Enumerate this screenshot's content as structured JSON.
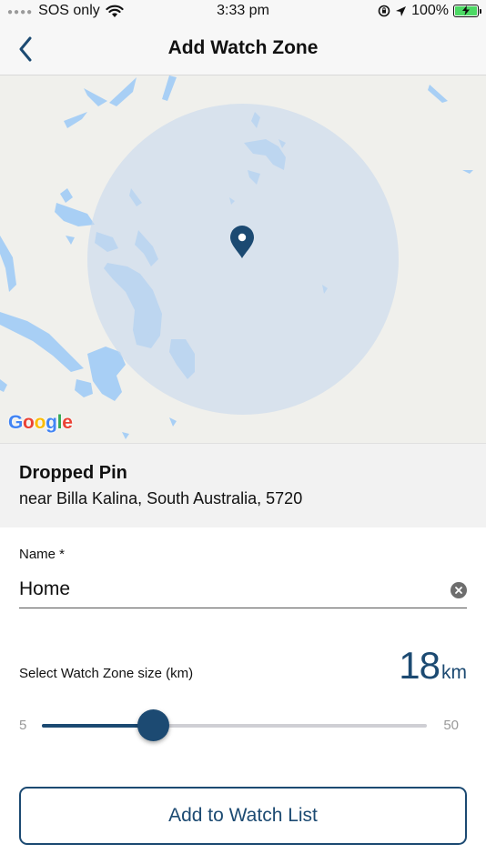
{
  "status_bar": {
    "carrier": "SOS only",
    "time": "3:33 pm",
    "battery": "100%",
    "signal_icon": "signal-dots-icon",
    "wifi_icon": "wifi-icon",
    "orientation_lock_icon": "orientation-lock-icon",
    "location_icon": "location-arrow-icon",
    "battery_icon": "battery-charging-icon"
  },
  "nav": {
    "title": "Add Watch Zone",
    "back_icon": "chevron-left-icon"
  },
  "map": {
    "attribution": "Google",
    "pin_icon": "map-pin-icon",
    "zone_fill_color": "#d9e4ef",
    "water_color": "#a8cff5",
    "land_color": "#f0f0ec"
  },
  "location": {
    "title": "Dropped Pin",
    "subtitle": "near Billa Kalina, South Australia, 5720"
  },
  "form": {
    "name_label": "Name *",
    "name_value": "Home",
    "clear_icon": "clear-circle-icon",
    "size_label": "Select Watch Zone size (km)",
    "size_value": "18",
    "size_unit": "km",
    "slider_min": "5",
    "slider_max": "50",
    "slider_value": 18,
    "slider_min_value": 5,
    "slider_max_value": 50
  },
  "actions": {
    "add_label": "Add to Watch List"
  },
  "colors": {
    "accent": "#1c4a72",
    "track": "#cfcfd4",
    "panel_bg": "#f2f2f2"
  }
}
